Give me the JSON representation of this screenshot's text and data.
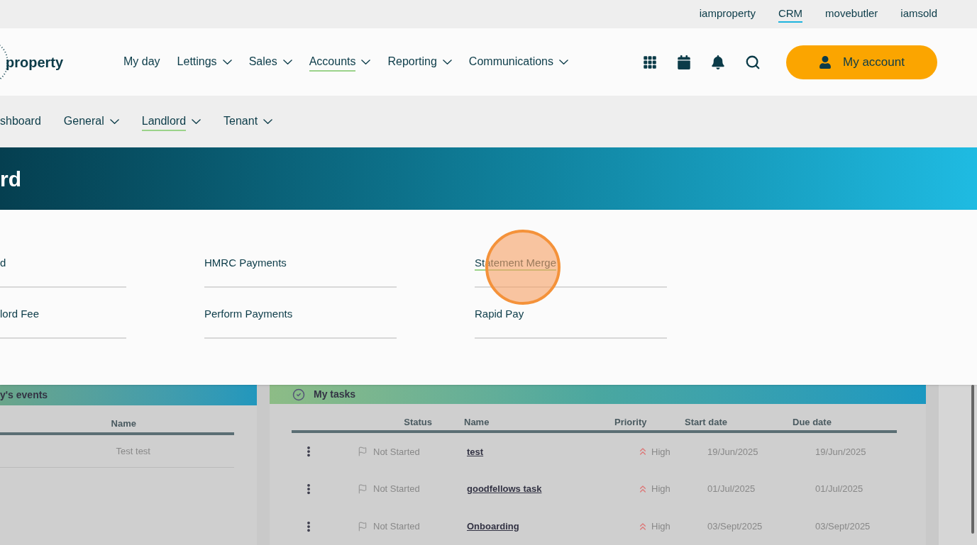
{
  "top_links": [
    {
      "label": "iamproperty",
      "selected": false
    },
    {
      "label": "CRM",
      "selected": true
    },
    {
      "label": "movebutler",
      "selected": false
    },
    {
      "label": "iamsold",
      "selected": false
    }
  ],
  "logo": {
    "text": "property"
  },
  "main_nav": [
    {
      "label": "My day",
      "dropdown": false,
      "selected": false
    },
    {
      "label": "Lettings",
      "dropdown": true,
      "selected": false
    },
    {
      "label": "Sales",
      "dropdown": true,
      "selected": false
    },
    {
      "label": "Accounts",
      "dropdown": true,
      "selected": true
    },
    {
      "label": "Reporting",
      "dropdown": true,
      "selected": false
    },
    {
      "label": "Communications",
      "dropdown": true,
      "selected": false
    }
  ],
  "account_button": "My account",
  "sub_nav": [
    {
      "label": "shboard",
      "dropdown": false,
      "selected": false
    },
    {
      "label": "General",
      "dropdown": true,
      "selected": false
    },
    {
      "label": "Landlord",
      "dropdown": true,
      "selected": true
    },
    {
      "label": "Tenant",
      "dropdown": true,
      "selected": false
    }
  ],
  "banner": {
    "title": "rd"
  },
  "menu": {
    "columns": [
      [
        {
          "label": "d",
          "selected": false
        },
        {
          "label": "lord Fee",
          "selected": false
        }
      ],
      [
        {
          "label": "HMRC Payments",
          "selected": false
        },
        {
          "label": "Perform Payments",
          "selected": false
        }
      ],
      [
        {
          "label": "Statement Merge",
          "selected": true
        },
        {
          "label": "Rapid Pay",
          "selected": false
        }
      ]
    ]
  },
  "events_panel": {
    "title": "y's events",
    "columns": [
      "Name"
    ],
    "rows": [
      [
        "Test test"
      ]
    ]
  },
  "tasks_panel": {
    "title": "My tasks",
    "columns": [
      "Status",
      "Name",
      "Priority",
      "Start date",
      "Due date"
    ],
    "rows": [
      {
        "status": "Not Started",
        "name": "test",
        "priority": "High",
        "start": "19/Jun/2025",
        "due": "19/Jun/2025"
      },
      {
        "status": "Not Started",
        "name": "goodfellows task",
        "priority": "High",
        "start": "01/Jul/2025",
        "due": "01/Jul/2025"
      },
      {
        "status": "Not Started",
        "name": "Onboarding",
        "priority": "High",
        "start": "03/Sept/2025",
        "due": "03/Sept/2025"
      }
    ]
  }
}
